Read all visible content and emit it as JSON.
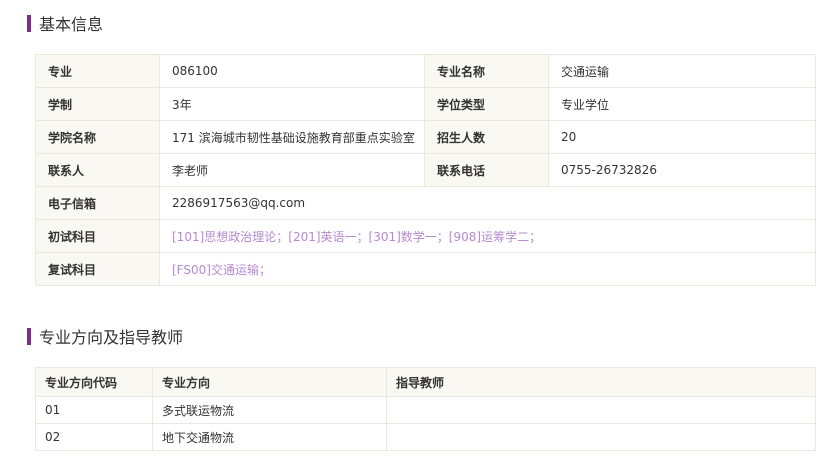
{
  "basic_info": {
    "title": "基本信息",
    "rows": [
      [
        {
          "label": "专业",
          "value": "086100"
        },
        {
          "label": "专业名称",
          "value": "交通运输"
        }
      ],
      [
        {
          "label": "学制",
          "value": "3年"
        },
        {
          "label": "学位类型",
          "value": "专业学位"
        }
      ],
      [
        {
          "label": "学院名称",
          "value": "171 滨海城市韧性基础设施教育部重点实验室"
        },
        {
          "label": "招生人数",
          "value": "20"
        }
      ],
      [
        {
          "label": "联系人",
          "value": "李老师"
        },
        {
          "label": "联系电话",
          "value": "0755-26732826"
        }
      ]
    ],
    "email": {
      "label": "电子信箱",
      "value": "2286917563@qq.com"
    },
    "initial_exam": {
      "label": "初试科目",
      "value": "[101]思想政治理论；[201]英语一；[301]数学一；[908]运筹学二；"
    },
    "retest": {
      "label": "复试科目",
      "value": "[FS00]交通运输；"
    }
  },
  "directions": {
    "title": "专业方向及指导教师",
    "headers": [
      "专业方向代码",
      "专业方向",
      "指导教师"
    ],
    "rows": [
      {
        "code": "01",
        "direction": "多式联运物流",
        "teacher": ""
      },
      {
        "code": "02",
        "direction": "地下交通物流",
        "teacher": ""
      }
    ]
  },
  "colors": {
    "accent": "#7a2f8c",
    "link": "#b58ad0",
    "border": "#ece7dc",
    "label_bg": "#faf8f3"
  }
}
